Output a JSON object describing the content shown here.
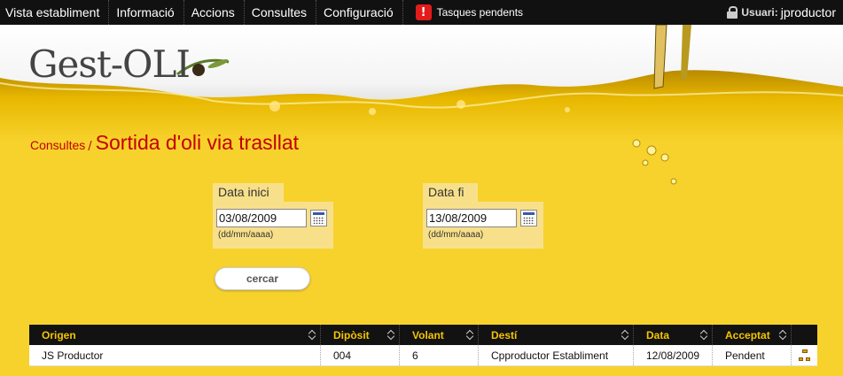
{
  "nav": {
    "items": [
      "Vista establiment",
      "Informació",
      "Accions",
      "Consultes",
      "Configuració"
    ],
    "tasks_label": "Tasques pendents",
    "tasks_icon": "alert-icon",
    "user_label": "Usuari:",
    "user_name": "jproductor"
  },
  "header": {
    "logo_text": "Gest-OLI"
  },
  "breadcrumb": {
    "section": "Consultes",
    "separator": "/",
    "title": "Sortida d'oli via trasllat"
  },
  "filters": {
    "start": {
      "label": "Data inici",
      "value": "03/08/2009",
      "hint": "(dd/mm/aaaa)"
    },
    "end": {
      "label": "Data fi",
      "value": "13/08/2009",
      "hint": "(dd/mm/aaaa)"
    },
    "search_label": "cercar"
  },
  "table": {
    "columns": [
      "Origen",
      "Dipòsit",
      "Volant",
      "Destí",
      "Data",
      "Acceptat"
    ],
    "rows": [
      [
        "JS Productor",
        "004",
        "6",
        "Cpproductor Establiment",
        "12/08/2009",
        "Pendent"
      ]
    ]
  },
  "colors": {
    "accent_red": "#c30000",
    "header_gold": "#f5c400",
    "background_yellow": "#f7d22c"
  }
}
